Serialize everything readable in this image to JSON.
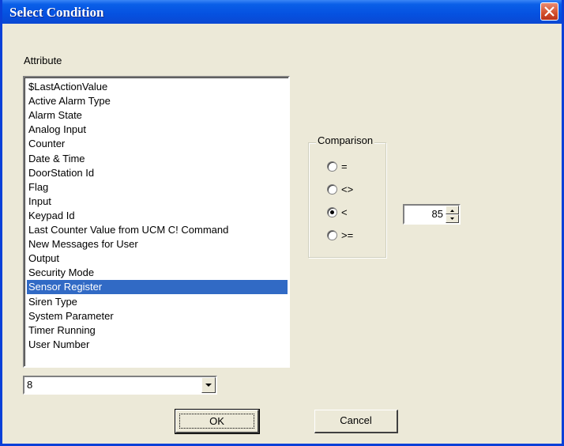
{
  "window": {
    "title": "Select Condition"
  },
  "attribute_label": "Attribute",
  "attribute_list": {
    "items": [
      "$LastActionValue",
      "Active Alarm Type",
      "Alarm State",
      "Analog Input",
      "Counter",
      "Date & Time",
      "DoorStation Id",
      "Flag",
      "Input",
      "Keypad Id",
      "Last Counter Value from UCM C! Command",
      "New Messages for User",
      "Output",
      "Security Mode",
      "Sensor Register",
      "Siren Type",
      "System Parameter",
      "Timer Running",
      "User Number"
    ],
    "selected": "Sensor Register"
  },
  "comparison": {
    "label": "Comparison",
    "options": [
      "=",
      "<>",
      "<",
      ">="
    ],
    "selected": "<"
  },
  "value_spinner": {
    "value": "85"
  },
  "combo": {
    "value": "8"
  },
  "buttons": {
    "ok": "OK",
    "cancel": "Cancel"
  },
  "colors": {
    "title_bar": "#0551e0",
    "selection": "#316ac5",
    "close": "#d34f2c"
  }
}
